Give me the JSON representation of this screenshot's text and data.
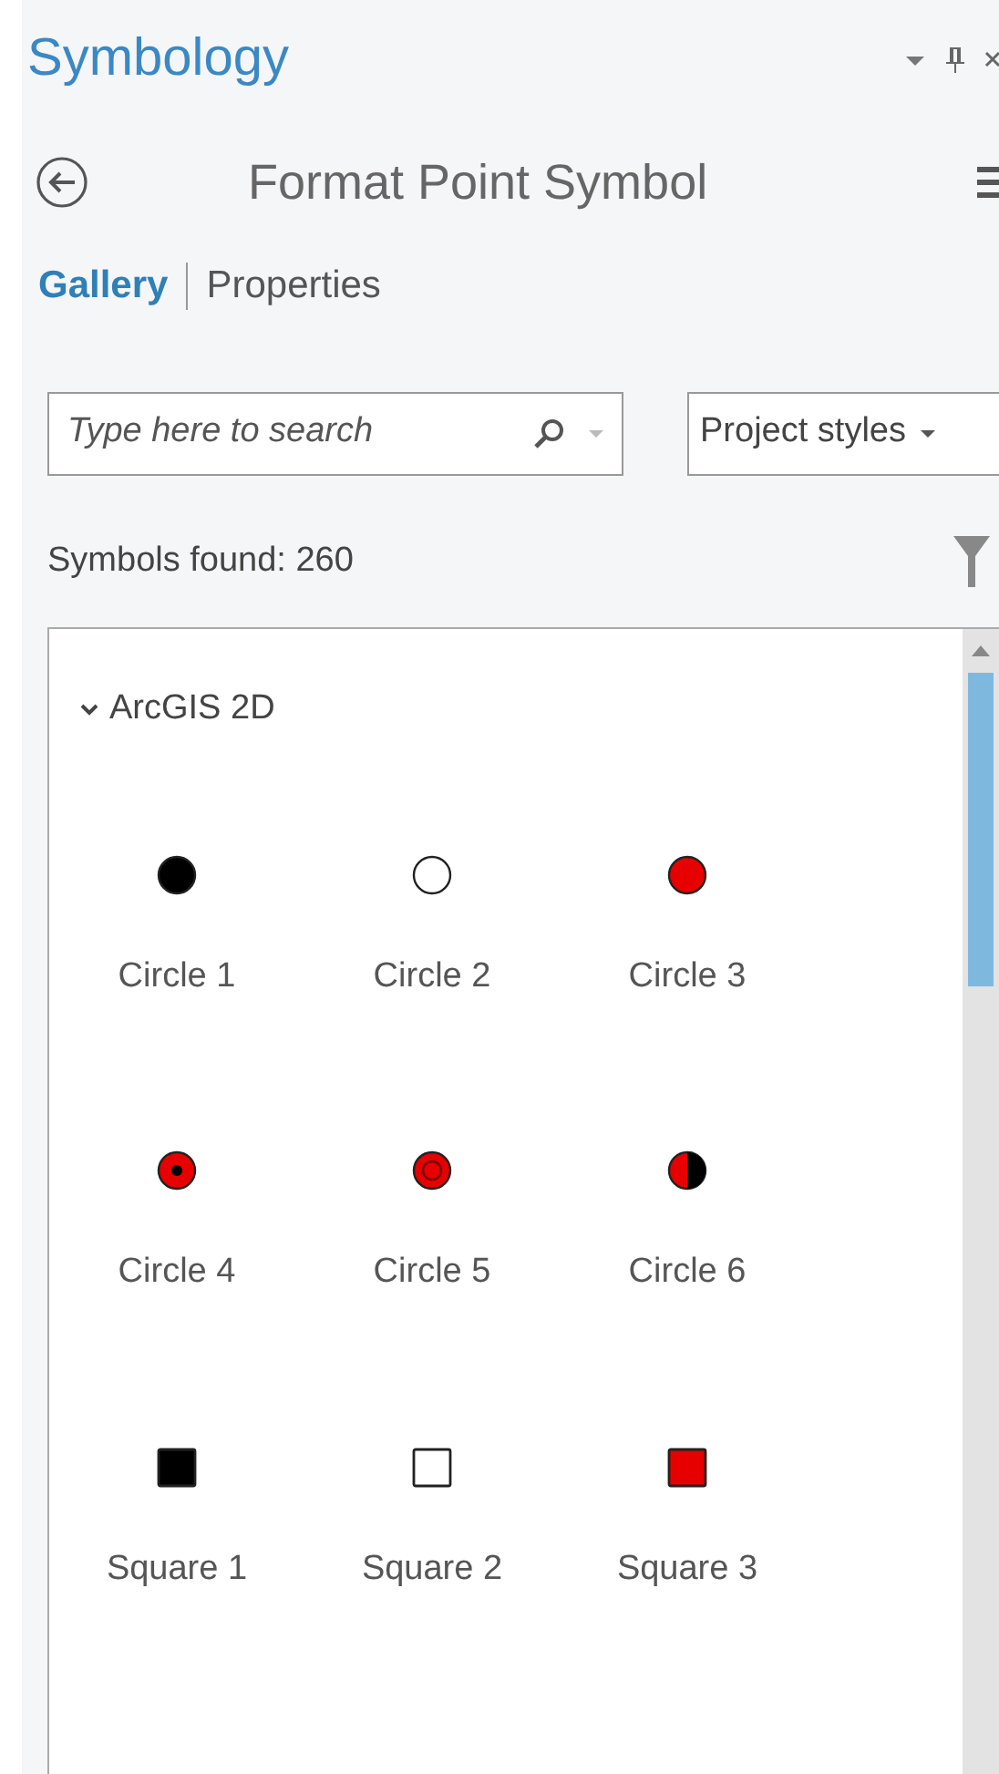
{
  "pane": {
    "title": "Symbology"
  },
  "header": {
    "title": "Format Point Symbol"
  },
  "tabs": [
    {
      "label": "Gallery",
      "selected": true
    },
    {
      "label": "Properties",
      "selected": false
    }
  ],
  "search": {
    "placeholder": "Type here to search"
  },
  "style_dropdown": {
    "value": "Project styles"
  },
  "result_count": "Symbols found: 260",
  "gallery": {
    "group": {
      "label": "ArcGIS 2D",
      "expanded": true
    },
    "symbols": [
      {
        "label": "Circle 1",
        "kind": "circle",
        "color": "#000000"
      },
      {
        "label": "Circle 2",
        "kind": "hollow-circle"
      },
      {
        "label": "Circle 3",
        "kind": "circle",
        "color": "#e60000"
      },
      {
        "label": "Circle 4",
        "kind": "dotted-circle",
        "color": "#e60000"
      },
      {
        "label": "Circle 5",
        "kind": "ringed-circle",
        "color": "#e60000"
      },
      {
        "label": "Circle 6",
        "kind": "half-circle",
        "color": "#e60000"
      },
      {
        "label": "Square 1",
        "kind": "square",
        "color": "#000000"
      },
      {
        "label": "Square 2",
        "kind": "hollow-square"
      },
      {
        "label": "Square 3",
        "kind": "square",
        "color": "#e60000"
      }
    ]
  }
}
